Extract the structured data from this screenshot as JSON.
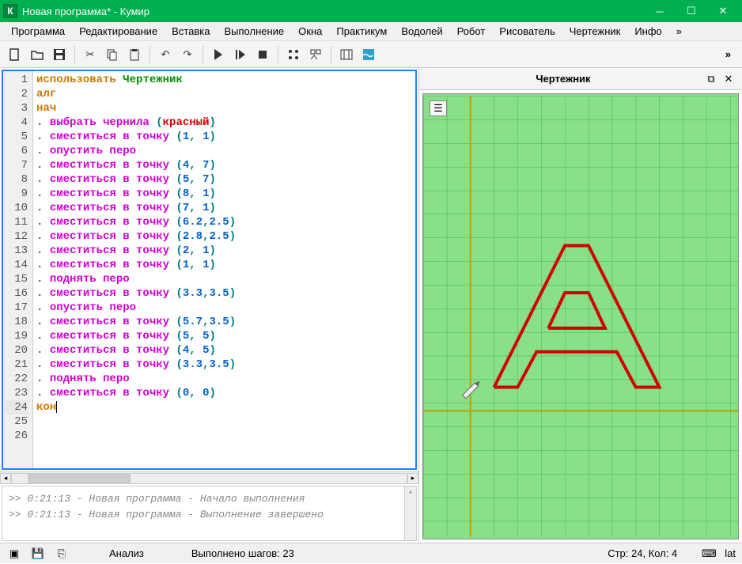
{
  "window": {
    "title": "Новая программа* - Кумир",
    "icon_letter": "К"
  },
  "menu": [
    "Программа",
    "Редактирование",
    "Вставка",
    "Выполнение",
    "Окна",
    "Практикум",
    "Водолей",
    "Робот",
    "Рисователь",
    "Чертежник",
    "Инфо",
    "»"
  ],
  "toolbar_chevron": "»",
  "code_lines": [
    {
      "n": 1,
      "t": "use"
    },
    {
      "n": 2,
      "t": "alg"
    },
    {
      "n": 3,
      "t": "nach"
    },
    {
      "n": 4,
      "t": "ink"
    },
    {
      "n": 5,
      "t": "mv",
      "a": "1",
      "b": "1"
    },
    {
      "n": 6,
      "t": "pd"
    },
    {
      "n": 7,
      "t": "mv",
      "a": "4",
      "b": "7"
    },
    {
      "n": 8,
      "t": "mv",
      "a": "5",
      "b": "7"
    },
    {
      "n": 9,
      "t": "mv",
      "a": "8",
      "b": "1"
    },
    {
      "n": 10,
      "t": "mv",
      "a": "7",
      "b": "1"
    },
    {
      "n": 11,
      "t": "mv",
      "a": "6.2",
      "b": "2.5"
    },
    {
      "n": 12,
      "t": "mv",
      "a": "2.8",
      "b": "2.5"
    },
    {
      "n": 13,
      "t": "mv",
      "a": "2",
      "b": "1"
    },
    {
      "n": 14,
      "t": "mv",
      "a": "1",
      "b": "1"
    },
    {
      "n": 15,
      "t": "pu"
    },
    {
      "n": 16,
      "t": "mv",
      "a": "3.3",
      "b": "3.5"
    },
    {
      "n": 17,
      "t": "pd"
    },
    {
      "n": 18,
      "t": "mv",
      "a": "5.7",
      "b": "3.5"
    },
    {
      "n": 19,
      "t": "mv",
      "a": "5",
      "b": "5"
    },
    {
      "n": 20,
      "t": "mv",
      "a": "4",
      "b": "5"
    },
    {
      "n": 21,
      "t": "mv",
      "a": "3.3",
      "b": "3.5"
    },
    {
      "n": 22,
      "t": "pu"
    },
    {
      "n": 23,
      "t": "mv",
      "a": "0",
      "b": "0"
    },
    {
      "n": 24,
      "t": "kon"
    },
    {
      "n": 25,
      "t": "empty"
    },
    {
      "n": 26,
      "t": "empty"
    }
  ],
  "kw": {
    "use": "использовать",
    "module": "Чертежник",
    "alg": "алг",
    "nach": "нач",
    "kon": "кон",
    "ink": "выбрать чернила",
    "color": "красный",
    "mv": "сместиться в точку",
    "pd": "опустить перо",
    "pu": "поднять перо"
  },
  "console": [
    ">>  0:21:13 - Новая программа - Начало выполнения",
    ">>  0:21:13 - Новая программа - Выполнение завершено"
  ],
  "right_panel": {
    "title": "Чертежник"
  },
  "status": {
    "analysis": "Анализ",
    "steps": "Выполнено шагов: 23",
    "pos": "Стр: 24, Кол: 4",
    "lang": "lat"
  }
}
